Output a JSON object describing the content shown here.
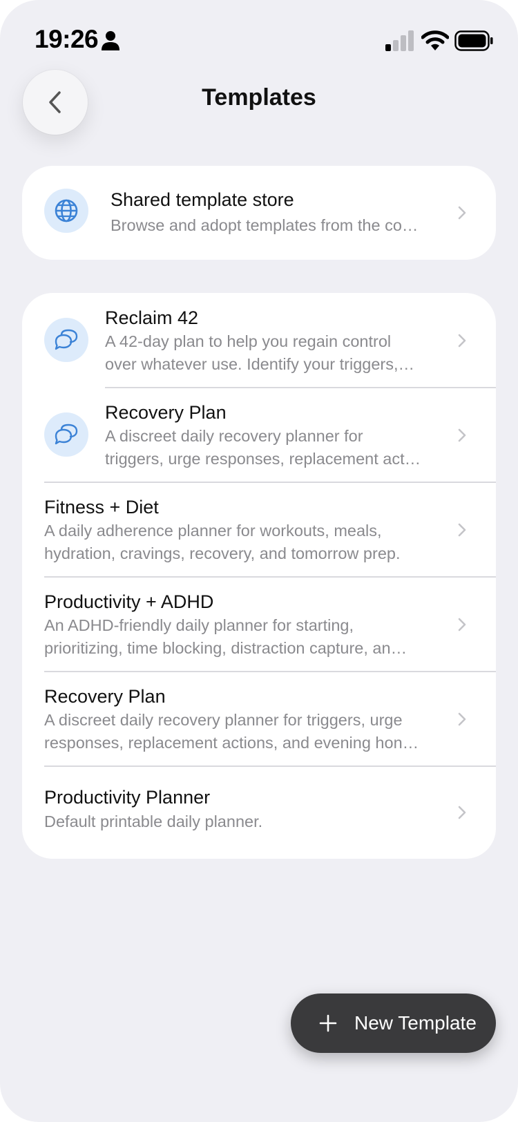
{
  "status_bar": {
    "time": "19:26",
    "icons": [
      "person-icon",
      "cellular-signal-icon",
      "wifi-icon",
      "battery-icon"
    ]
  },
  "header": {
    "back_icon": "chevron-left-icon",
    "title": "Templates"
  },
  "store": {
    "icon": "globe-icon",
    "title": "Shared template store",
    "description": "Browse and adopt templates from the co…"
  },
  "templates": [
    {
      "icon": "chat-bubbles-icon",
      "title": "Reclaim 42",
      "line1": "A 42-day plan to help you regain control",
      "line2": "over whatever use. Identify your triggers,…"
    },
    {
      "icon": "chat-bubbles-icon",
      "title": "Recovery Plan",
      "line1": "A discreet daily recovery planner for",
      "line2": "triggers, urge responses, replacement act…"
    },
    {
      "title": "Fitness + Diet",
      "line1": "A daily adherence planner for workouts, meals,",
      "line2": "hydration, cravings, recovery, and tomorrow prep."
    },
    {
      "title": "Productivity + ADHD",
      "line1": "An ADHD-friendly daily planner for starting,",
      "line2": "prioritizing, time blocking, distraction capture, an…"
    },
    {
      "title": "Recovery Plan",
      "line1": "A discreet daily recovery planner for triggers, urge",
      "line2": "responses, replacement actions, and evening hon…"
    },
    {
      "title": "Productivity Planner",
      "line1": "Default printable daily planner."
    }
  ],
  "fab": {
    "icon": "plus-icon",
    "label": "New Template"
  },
  "colors": {
    "background": "#efeff4",
    "card": "#ffffff",
    "accent_icon": "#3b82d6",
    "icon_bubble": "#ddebfb",
    "fab": "#3a3a3c",
    "secondary_text": "#8a8a8e"
  }
}
